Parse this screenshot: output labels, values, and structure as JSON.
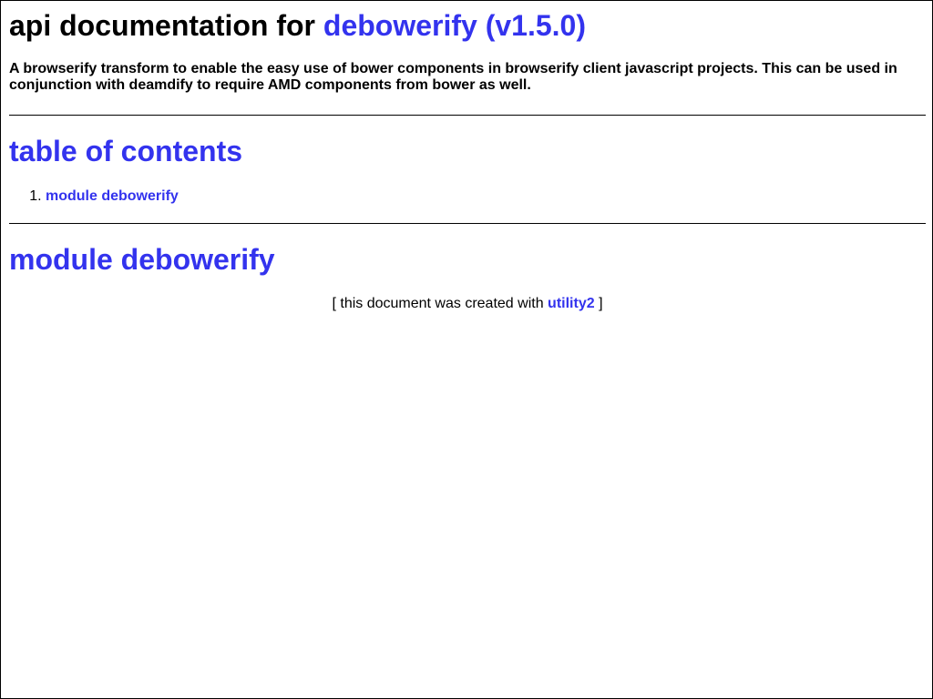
{
  "header": {
    "title_prefix": "api documentation for",
    "title_link": "debowerify (v1.5.0)"
  },
  "description": "A browserify transform to enable the easy use of bower components in browserify client javascript projects. This can be used in conjunction with deamdify to require AMD components from bower as well.",
  "toc": {
    "heading": "table of contents",
    "items": [
      {
        "number": "1.",
        "label": "module debowerify"
      }
    ]
  },
  "module": {
    "heading": "module debowerify"
  },
  "footer": {
    "prefix": "[ this document was created with",
    "link": "utility2",
    "suffix": "]"
  },
  "colors": {
    "link": "#3333ee",
    "text": "#000000",
    "background": "#ffffff"
  }
}
